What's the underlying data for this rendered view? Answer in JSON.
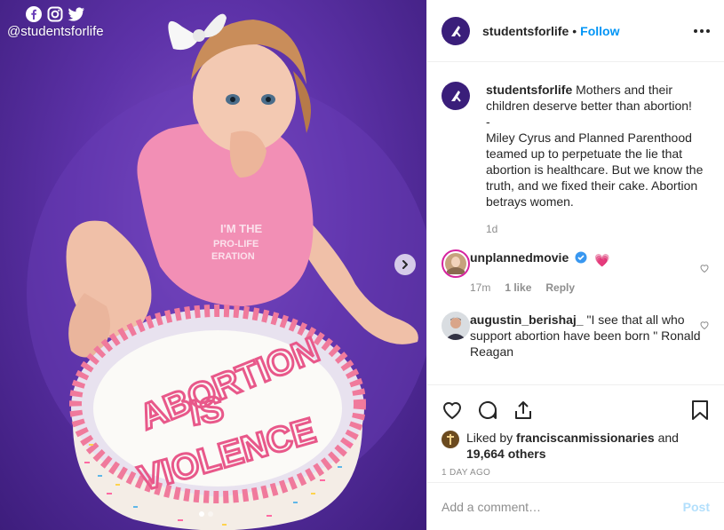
{
  "photo": {
    "watermark_handle": "@studentsforlife",
    "shirt_text": "I'M THE\nPRO-LIFE\nGENERATION",
    "cake_text": [
      "ABORTION",
      "IS",
      "VIOLENCE"
    ]
  },
  "header": {
    "username": "studentsforlife",
    "separator": "•",
    "follow_label": "Follow"
  },
  "caption": {
    "username": "studentsforlife",
    "text": "Mothers and their children deserve better than abortion!\n-\nMiley Cyrus and Planned Parenthood teamed up to perpetuate the lie that abortion is healthcare. But we know the truth, and we fixed their cake. Abortion betrays women.",
    "age": "1d"
  },
  "comments": [
    {
      "username": "unplannedmovie",
      "verified": true,
      "text": "💗",
      "age": "17m",
      "likes": "1 like",
      "reply_label": "Reply"
    },
    {
      "username": "augustin_berishaj_",
      "text": "\"I see that all who support abortion have been born \" Ronald Reagan"
    }
  ],
  "likes": {
    "prefix": "Liked by",
    "user": "franciscanmissionaries",
    "conj": "and",
    "others": "19,664 others"
  },
  "timestamp": "1 DAY AGO",
  "add_comment": {
    "placeholder": "Add a comment…",
    "post_label": "Post"
  },
  "colors": {
    "accent": "#0095f6",
    "post_disabled": "#b2dffc",
    "background_purple": "#5d32a8"
  }
}
